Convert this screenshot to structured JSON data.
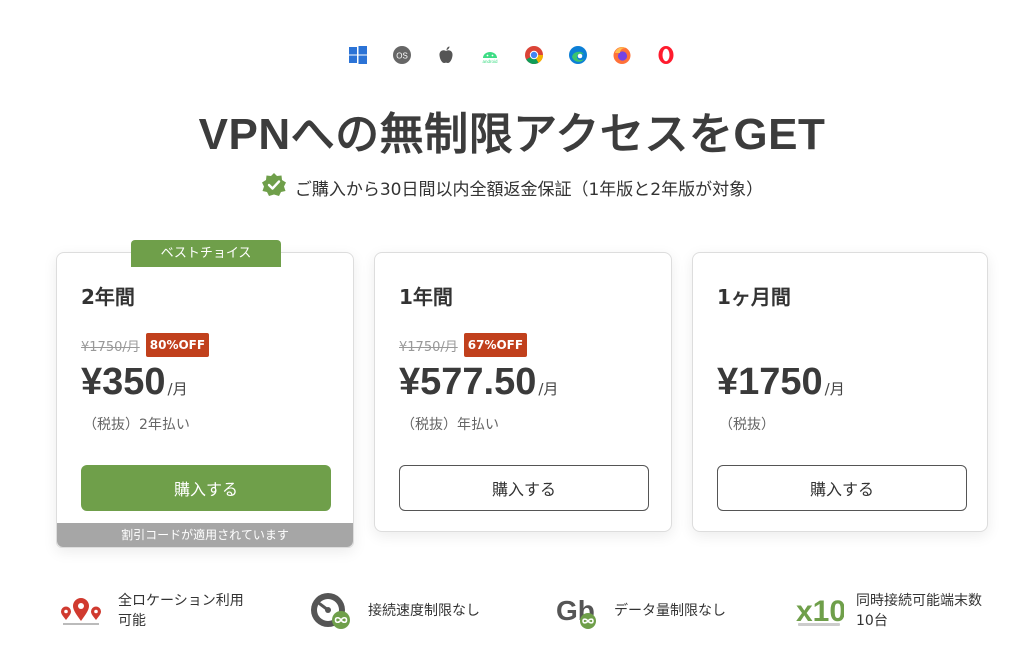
{
  "platforms": [
    {
      "icon": "windows-icon",
      "color": "#2b73d6"
    },
    {
      "icon": "macos-icon",
      "label": "OS",
      "color": "#666666"
    },
    {
      "icon": "apple-icon",
      "color": "#555555"
    },
    {
      "icon": "android-icon",
      "label": "android",
      "color": "#3ddc84"
    },
    {
      "icon": "chrome-icon"
    },
    {
      "icon": "edge-icon"
    },
    {
      "icon": "firefox-icon"
    },
    {
      "icon": "opera-icon",
      "color": "#ff1b2d"
    }
  ],
  "headline": "VPNへの無制限アクセスをGET",
  "guarantee": {
    "icon": "check-badge-icon",
    "text": "ご購入から30日間以内全額返金保証（1年版と2年版が対象）"
  },
  "plans": [
    {
      "badge": "ベストチョイス",
      "name": "2年間",
      "old_price": "¥1750/月",
      "discount": "80%OFF",
      "price": "¥350",
      "per": "/月",
      "tax_note": "（税抜）2年払い",
      "button": "購入する",
      "coupon_note": "割引コードが適用されています"
    },
    {
      "name": "1年間",
      "old_price": "¥1750/月",
      "discount": "67%OFF",
      "price": "¥577.50",
      "per": "/月",
      "tax_note": "（税抜）年払い",
      "button": "購入する"
    },
    {
      "name": "1ヶ月間",
      "price": "¥1750",
      "per": "/月",
      "tax_note": "（税抜）",
      "button": "購入する"
    }
  ],
  "features": [
    {
      "icon": "location-pins-icon",
      "text": "全ロケーション利用可能"
    },
    {
      "icon": "speedometer-infinity-icon",
      "text": "接続速度制限なし"
    },
    {
      "icon": "gb-infinity-icon",
      "label": "Gb",
      "text": "データ量制限なし"
    },
    {
      "icon": "x10-devices-icon",
      "label": "x10",
      "text": "同時接続可能端末数 10台"
    }
  ],
  "colors": {
    "accent": "#6f9f4a",
    "discount": "#c1401c",
    "coupon_bar": "#a6a6a6"
  }
}
